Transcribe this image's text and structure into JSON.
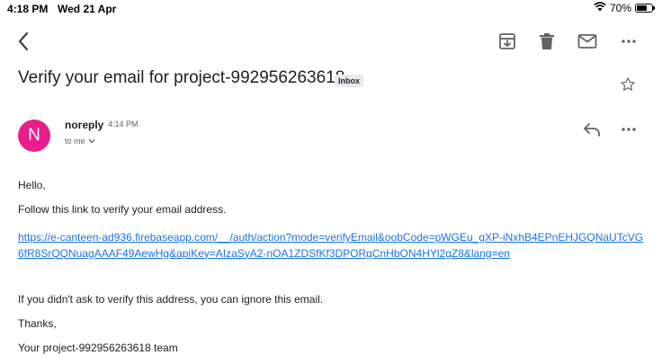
{
  "status_bar": {
    "time": "4:18 PM",
    "date": "Wed 21 Apr",
    "battery_percent": "70%",
    "battery_level": 0.7,
    "icons": [
      "wifi-icon",
      "battery-icon"
    ]
  },
  "toolbar": {
    "icons": [
      "back-icon",
      "archive-icon",
      "trash-icon",
      "mail-icon",
      "more-icon"
    ]
  },
  "email": {
    "subject": "Verify your email for project-992956263618",
    "label": "Inbox",
    "sender": {
      "avatar_letter": "N",
      "avatar_color": "#e91e8c",
      "name": "noreply",
      "time": "4:14 PM",
      "recipient": "to me"
    },
    "body": {
      "greeting": "Hello,",
      "line1": "Follow this link to verify your email address.",
      "link": "https://e-canteen-ad936.firebaseapp.com/__/auth/action?mode=verifyEmail&oobCode=pWGEu_gXP-iNxhB4EPnEHJGQNaUTcVG6fR8SrQQNuagAAAF49AewHg&apiKey=AIzaSyA2-nOA1ZDSfKf3DPORgCnHbON4HYl2gZ8&lang=en",
      "line2": "If you didn't ask to verify this address, you can ignore this email.",
      "thanks": "Thanks,",
      "signature": "Your project-992956263618 team"
    }
  },
  "colors": {
    "link": "#1a73e8",
    "text": "#202124",
    "secondary": "#5f6368"
  }
}
